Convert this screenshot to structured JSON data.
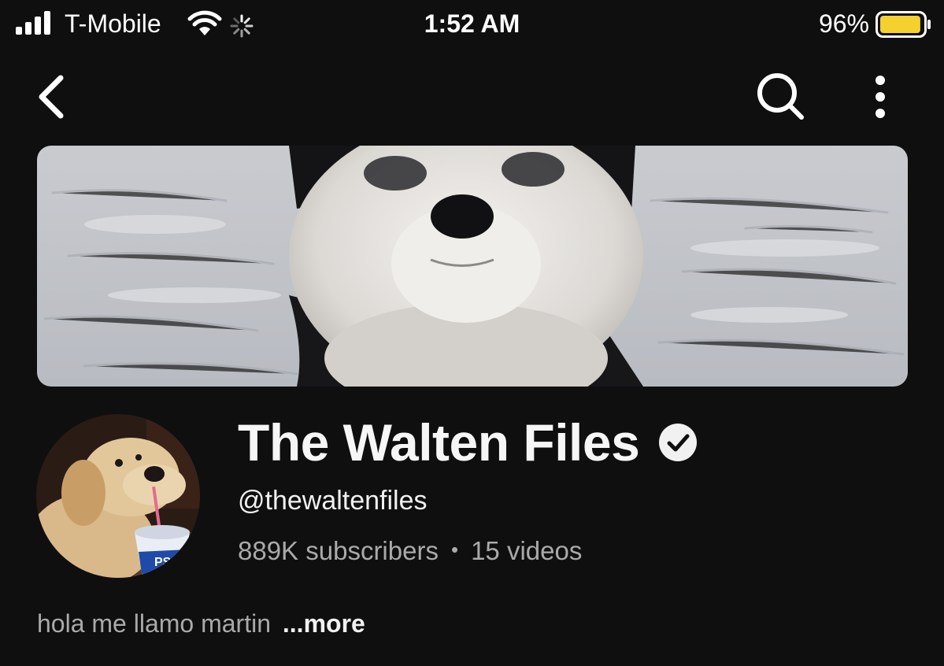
{
  "status_bar": {
    "carrier": "T-Mobile",
    "time": "1:52 AM",
    "battery_percent": "96%",
    "battery_level": 0.96,
    "battery_color": "#f5d130",
    "signal_bars": 4
  },
  "nav": {
    "back_icon": "chevron-left-icon",
    "search_icon": "search-icon",
    "more_icon": "more-vertical-icon"
  },
  "channel": {
    "title": "The Walten Files",
    "verified": true,
    "handle": "@thewaltenfiles",
    "subscribers": "889K subscribers",
    "separator": "•",
    "videos": "15 videos",
    "description": "hola me llamo martin",
    "more_label": "...more"
  },
  "colors": {
    "background": "#0f0f10",
    "primary_text": "#f1f1f1",
    "secondary_text": "#aaaaaa"
  }
}
